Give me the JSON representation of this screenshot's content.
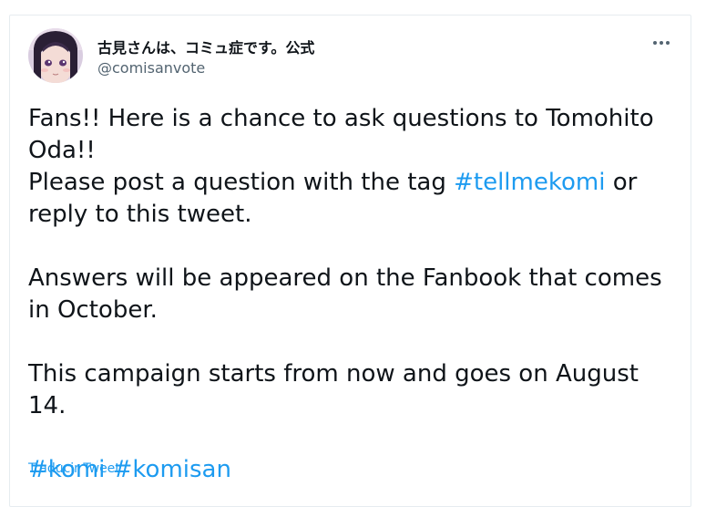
{
  "author": {
    "display_name": "古見さんは、コミュ症です。公式",
    "handle": "@comisanvote"
  },
  "tweet": {
    "line1": "Fans!! Here is a chance to ask questions to Tomohito Oda!!",
    "line2_before": "Please post a question with the tag ",
    "line2_hashtag": "#tellmekomi",
    "line2_after": "  or reply to this tweet.",
    "line3": "Answers will be appeared on the Fanbook that comes in October.",
    "line4": "This campaign starts from now and goes on August 14.",
    "hashtag1": "#komi",
    "hashtag2": "#komisan"
  },
  "actions": {
    "translate": "Traducir Tweet",
    "more_icon": "more-horizontal-icon"
  },
  "colors": {
    "link": "#1d9bf0",
    "text": "#0f1419",
    "secondary": "#536471",
    "border": "#e6ecf0"
  }
}
